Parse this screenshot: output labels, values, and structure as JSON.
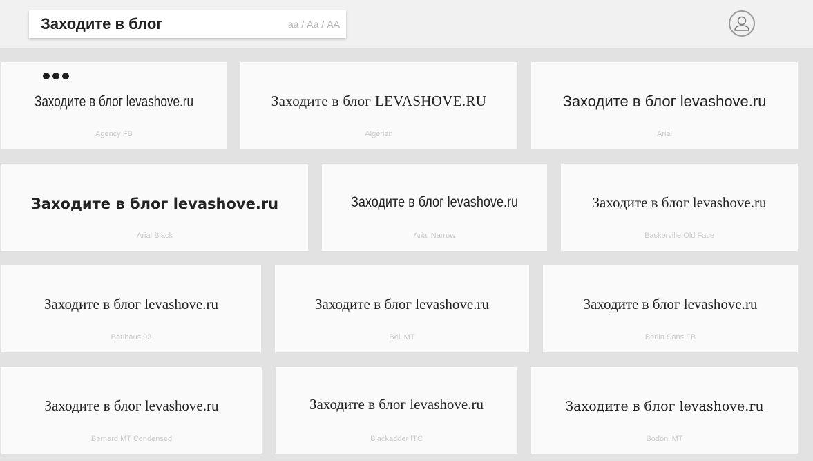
{
  "preview": {
    "text": "Заходите в блог",
    "case_lower": "aa",
    "case_title": "Aa",
    "case_upper": "AA",
    "separator": "/"
  },
  "cards": [
    {
      "sample": "Заходите в блог levashove.ru",
      "font_name": "Agency FB"
    },
    {
      "sample": "Заходите в блог LEVASHOVE.RU",
      "font_name": "Algerian"
    },
    {
      "sample": "Заходите в блог levashove.ru",
      "font_name": "Arial"
    },
    {
      "sample": "Заходите в блог levashove.ru",
      "font_name": "Arial Black"
    },
    {
      "sample": "Заходите в блог levashove.ru",
      "font_name": "Arial Narrow"
    },
    {
      "sample": "Заходите в блог levashove.ru",
      "font_name": "Baskerville Old Face"
    },
    {
      "sample": "Заходите в блог levashove.ru",
      "font_name": "Bauhaus 93"
    },
    {
      "sample": "Заходите в блог levashove.ru",
      "font_name": "Bell MT"
    },
    {
      "sample": "Заходите в блог levashove.ru",
      "font_name": "Berlin Sans FB"
    },
    {
      "sample": "Заходите в блог levashove.ru",
      "font_name": "Bernard MT Condensed"
    },
    {
      "sample": "Заходите в блог levashove.ru",
      "font_name": "Blackadder ITC"
    },
    {
      "sample": "Заходите в блог levashove.ru",
      "font_name": "Bodoni MT"
    }
  ]
}
